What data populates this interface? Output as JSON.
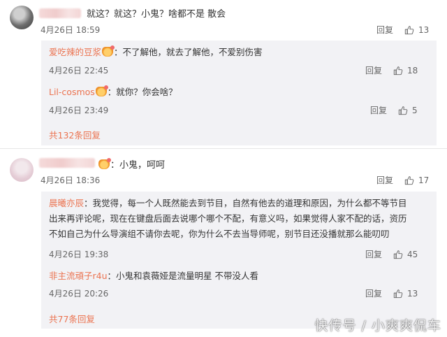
{
  "comments": [
    {
      "text": "就这？就这？小鬼？啥都不是  散会",
      "time": "4月26日 18:59",
      "reply": "回复",
      "likes": "13",
      "replies": [
        {
          "name": "爱吃辣的豆浆",
          "text": "：不了解他，就去了解他，不爱别伤害",
          "time": "4月26日 22:45",
          "reply": "回复",
          "likes": "18"
        },
        {
          "name": "Lil-cosmos",
          "text": "：就你？你会啥？",
          "time": "4月26日 23:49",
          "reply": "回复",
          "likes": "5"
        }
      ],
      "more": "共132条回复"
    },
    {
      "text": "：小鬼，呵呵",
      "time": "4月26日 18:36",
      "reply": "回复",
      "likes": "17",
      "replies": [
        {
          "name": "晨曦亦辰",
          "lines": [
            "：我觉得，每一个人既然能去到节目，自然有他去的道理和原因，为什么都不等节目",
            "出来再评论呢，现在在键盘后面去说哪个哪个不配，有意义吗，如果觉得人家不配的话，资历",
            "不如自己为什么导演组不请你去呢，你为什么不去当导师呢，别节目还没播就那么能叨叨"
          ],
          "time": "4月26日 19:38",
          "reply": "回复",
          "likes": "45"
        },
        {
          "name": "非主流頑子r4u",
          "text": "：小鬼和袁薇娅是流量明星 不带没人看",
          "time": "4月26日 20:26",
          "reply": "回复",
          "likes": "13"
        }
      ],
      "more": "共77条回复"
    }
  ],
  "watermark": "快传号 / 小爽爽侃车",
  "icons": {
    "like": "thumbs-up-icon",
    "badge": "vip-badge-icon"
  },
  "colors": {
    "name": "#eb7350",
    "reply_bg": "#f2f2f5"
  }
}
